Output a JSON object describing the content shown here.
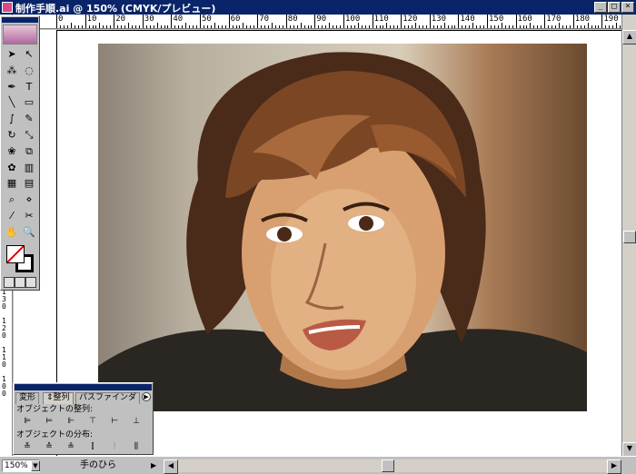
{
  "window": {
    "title": "制作手順.ai @ 150% (CMYK/プレビュー)",
    "minimize": "_",
    "maximize": "□",
    "close": "×"
  },
  "ruler": {
    "top_labels": [
      "0",
      "10",
      "20",
      "30",
      "40",
      "50",
      "60",
      "70",
      "80",
      "90",
      "100",
      "110",
      "120",
      "130",
      "140",
      "150",
      "160",
      "170",
      "180",
      "190"
    ],
    "left_labels": [
      "130",
      "120",
      "110",
      "100"
    ]
  },
  "status": {
    "zoom": "150%",
    "tool": "手のひら"
  },
  "tools_panel": {
    "tools": [
      {
        "name": "selection-tool",
        "glyph": "➤"
      },
      {
        "name": "direct-selection-tool",
        "glyph": "↖"
      },
      {
        "name": "magic-wand-tool",
        "glyph": "⁂"
      },
      {
        "name": "lasso-tool",
        "glyph": "◌"
      },
      {
        "name": "pen-tool",
        "glyph": "✒"
      },
      {
        "name": "type-tool",
        "glyph": "T"
      },
      {
        "name": "line-tool",
        "glyph": "╲"
      },
      {
        "name": "rectangle-tool",
        "glyph": "▭"
      },
      {
        "name": "paintbrush-tool",
        "glyph": "∫"
      },
      {
        "name": "pencil-tool",
        "glyph": "✎"
      },
      {
        "name": "rotate-tool",
        "glyph": "↻"
      },
      {
        "name": "scale-tool",
        "glyph": "⤡"
      },
      {
        "name": "warp-tool",
        "glyph": "❀"
      },
      {
        "name": "free-transform-tool",
        "glyph": "⧉"
      },
      {
        "name": "symbol-sprayer-tool",
        "glyph": "✿"
      },
      {
        "name": "graph-tool",
        "glyph": "▥"
      },
      {
        "name": "mesh-tool",
        "glyph": "▦"
      },
      {
        "name": "gradient-tool",
        "glyph": "▤"
      },
      {
        "name": "eyedropper-tool",
        "glyph": "⌕"
      },
      {
        "name": "blend-tool",
        "glyph": "⋄"
      },
      {
        "name": "slice-tool",
        "glyph": "⁄"
      },
      {
        "name": "scissors-tool",
        "glyph": "✂"
      },
      {
        "name": "hand-tool",
        "glyph": "✋"
      },
      {
        "name": "zoom-tool",
        "glyph": "🔍"
      }
    ]
  },
  "align_panel": {
    "tabs": [
      "変形",
      "整列",
      "パスファインダ"
    ],
    "menu": "▶",
    "section1": "オブジェクトの整列:",
    "section2": "オブジェクトの分布:",
    "align_buttons": [
      "⊫",
      "⊨",
      "⊩",
      "⊤",
      "⊢",
      "⊥"
    ],
    "distribute_buttons": [
      "≚",
      "≙",
      "≗",
      "⫿",
      "⫶",
      "⫼"
    ]
  },
  "colors": {
    "titlebar": "#0a246a",
    "chrome": "#c0c0c0"
  }
}
